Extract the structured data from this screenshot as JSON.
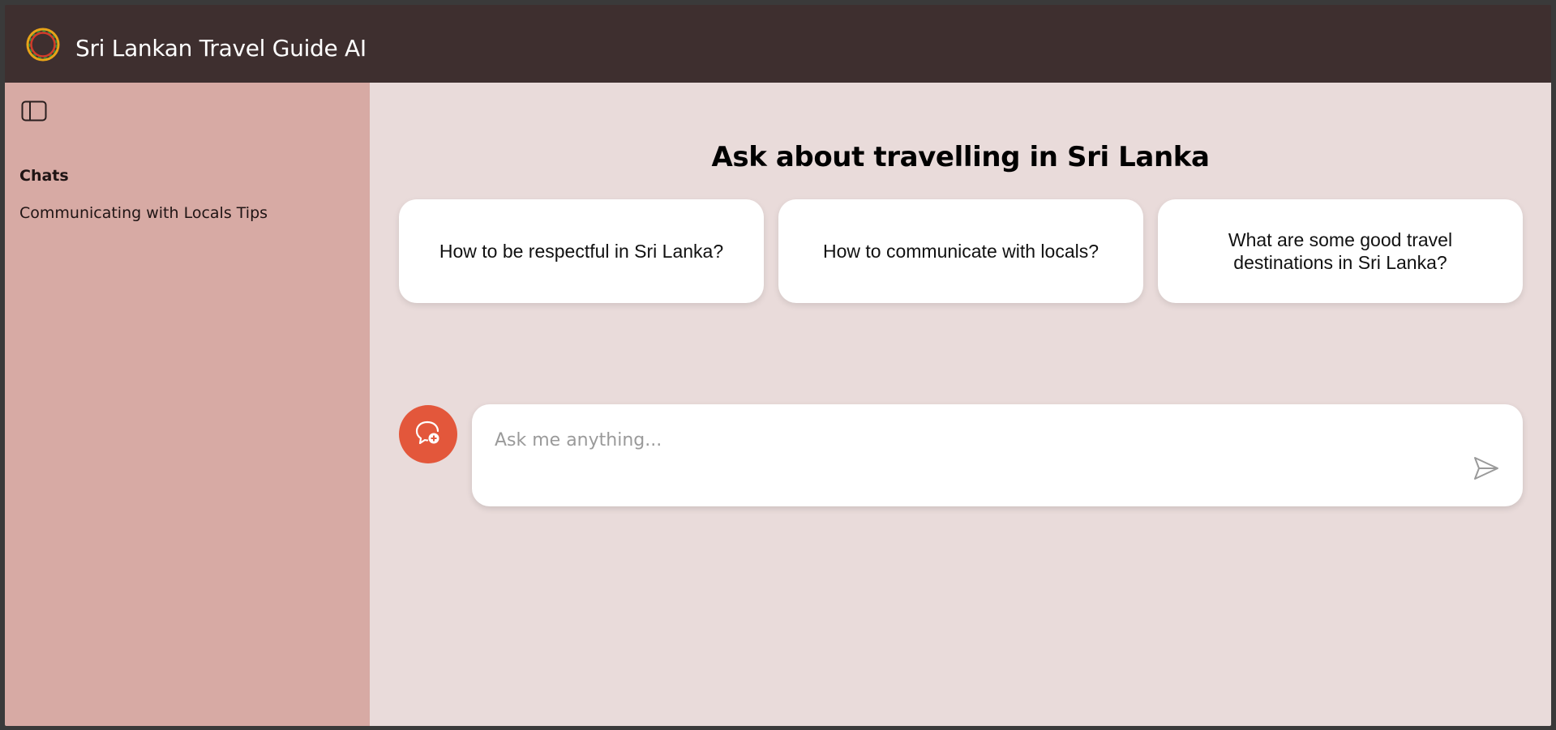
{
  "app": {
    "title": "Sri Lankan Travel Guide AI",
    "logo_icon": "sun-ring-logo-icon"
  },
  "sidebar": {
    "toggle_icon": "sidebar-toggle-icon",
    "heading": "Chats",
    "items": [
      {
        "label": "Communicating with Locals Tips"
      }
    ]
  },
  "main": {
    "heading": "Ask about travelling in Sri Lanka",
    "suggestions": [
      {
        "label": "How to be respectful in Sri Lanka?"
      },
      {
        "label": "How to communicate with locals?"
      },
      {
        "label": "What are some good travel destinations in Sri Lanka?"
      }
    ],
    "new_chat_icon": "new-chat-icon",
    "input": {
      "placeholder": "Ask me anything...",
      "value": ""
    },
    "send_icon": "send-icon"
  },
  "colors": {
    "topbar": "#3e2f2f",
    "sidebar": "#d7aaa4",
    "main_bg": "#e9dbda",
    "accent": "#e3573b",
    "card_bg": "#ffffff"
  }
}
